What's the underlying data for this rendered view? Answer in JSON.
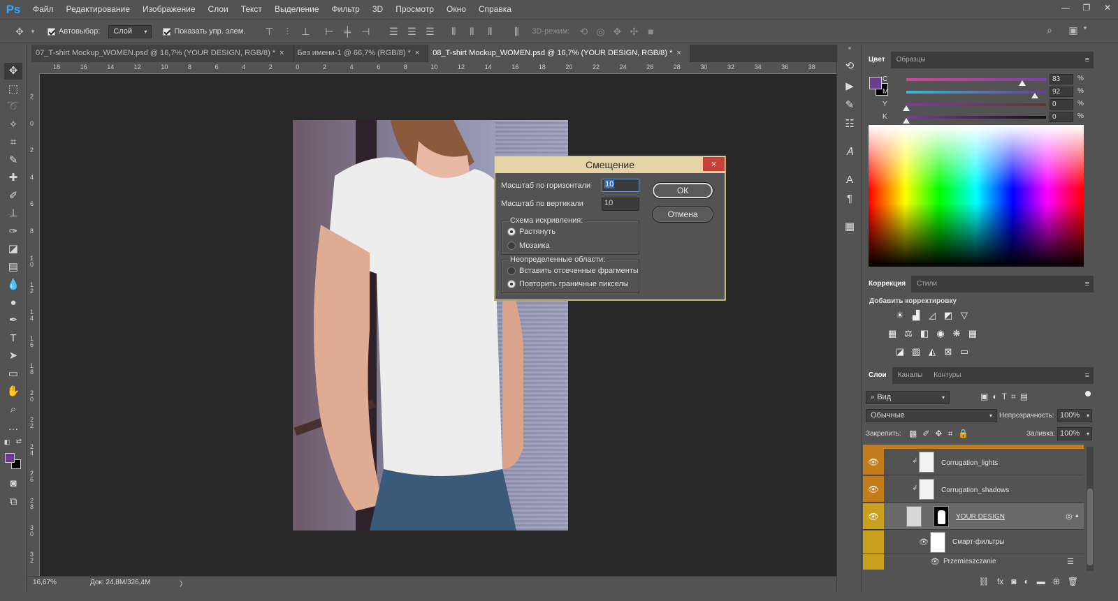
{
  "menu": {
    "logo": "Ps",
    "items": [
      "Файл",
      "Редактирование",
      "Изображение",
      "Слои",
      "Текст",
      "Выделение",
      "Фильтр",
      "3D",
      "Просмотр",
      "Окно",
      "Справка"
    ]
  },
  "options": {
    "autoselect_label": "Автовыбор:",
    "autoselect_value": "Слой",
    "show_controls_label": "Показать упр. элем.",
    "mode3d_label": "3D-режим:"
  },
  "tabs": [
    {
      "label": "07_T-shirt Mockup_WOMEN.psd @ 16,7% (YOUR DESIGN, RGB/8) *",
      "close": "×"
    },
    {
      "label": "Без имени-1 @ 66,7% (RGB/8) *",
      "close": "×"
    },
    {
      "label": "08_T-shirt Mockup_WOMEN.psd @ 16,7% (YOUR DESIGN, RGB/8) *",
      "close": "×"
    }
  ],
  "ruler_top": [
    "18",
    "16",
    "14",
    "12",
    "10",
    "8",
    "6",
    "4",
    "2",
    "0",
    "2",
    "4",
    "6",
    "8",
    "10",
    "12",
    "14",
    "16",
    "18",
    "20",
    "22",
    "24",
    "26",
    "28",
    "30",
    "32",
    "34",
    "36",
    "38"
  ],
  "ruler_left": [
    "2",
    "0",
    "2",
    "4",
    "6",
    "8",
    "1 0",
    "1 2",
    "1 4",
    "1 6",
    "1 8",
    "2 0",
    "2 2",
    "2 4",
    "2 6",
    "2 8",
    "3 0",
    "3 2"
  ],
  "dialog": {
    "title": "Смещение",
    "close": "×",
    "h_label": "Масштаб по горизонтали",
    "h_value": "10",
    "v_label": "Масштаб по вертикали",
    "v_value": "10",
    "ok": "ОК",
    "cancel": "Отмена",
    "scheme_title": "Схема искривления:",
    "scheme_options": [
      "Растянуть",
      "Мозаика"
    ],
    "undef_title": "Неопределенные области:",
    "undef_options": [
      "Вставить отсеченные фрагменты",
      "Повторить граничные пикселы"
    ]
  },
  "status": {
    "zoom": "16,67%",
    "doc": "Док: 24,8M/326,4M",
    "arrow": "〉"
  },
  "color_panel": {
    "tabs": [
      "Цвет",
      "Образцы"
    ],
    "sliders": [
      {
        "label": "C",
        "value": "83",
        "pct": "%",
        "level": 0.83,
        "color": "linear-gradient(90deg,#d6449a,#7d3fa8)"
      },
      {
        "label": "M",
        "value": "92",
        "pct": "%",
        "level": 0.92,
        "color": "linear-gradient(90deg,#3fb8d8,#6a3d99)"
      },
      {
        "label": "Y",
        "value": "0",
        "pct": "%",
        "level": 0.0,
        "color": "linear-gradient(90deg,#7b3d9c,#5a3a30)"
      },
      {
        "label": "K",
        "value": "0",
        "pct": "%",
        "level": 0.0,
        "color": "linear-gradient(90deg,#7b3d9c,#111)"
      }
    ],
    "fg_color": "#6a3d8f",
    "bg_color": "#000000"
  },
  "adjust_panel": {
    "tabs": [
      "Коррекция",
      "Стили"
    ],
    "title": "Добавить корректировку"
  },
  "layers_panel": {
    "tabs": [
      "Слои",
      "Каналы",
      "Контуры"
    ],
    "filter": "Вид",
    "blend": "Обычные",
    "opacity_label": "Непрозрачность:",
    "opacity_value": "100%",
    "lock_label": "Закрепить:",
    "fill_label": "Заливка:",
    "fill_value": "100%",
    "layers": [
      "Corrugation_lights",
      "Corrugation_shadows",
      "YOUR DESIGN",
      "Смарт-фильтры",
      "Przemieszczanie"
    ]
  }
}
